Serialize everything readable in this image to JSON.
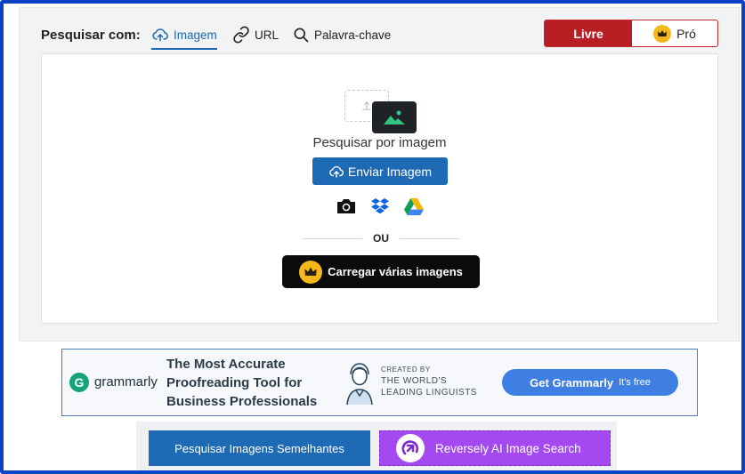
{
  "search": {
    "label": "Pesquisar com:",
    "modes": [
      {
        "label": "Imagem",
        "icon": "cloud-upload-icon",
        "active": true
      },
      {
        "label": "URL",
        "icon": "link-icon",
        "active": false
      },
      {
        "label": "Palavra-chave",
        "icon": "search-icon",
        "active": false
      }
    ],
    "plans": {
      "free": "Livre",
      "pro": "Pró"
    }
  },
  "drop_zone": {
    "title": "Pesquisar por imagem",
    "upload_button": "Enviar Imagem",
    "sources": [
      "camera-icon",
      "dropbox-icon",
      "google-drive-icon"
    ],
    "divider": "OU",
    "multi_button": "Carregar várias imagens"
  },
  "ad": {
    "brand": "grammarly",
    "headline_lines": [
      "The Most Accurate",
      "Proofreading Tool for",
      "Business Professionals"
    ],
    "credit_small": "CREATED BY",
    "credit_lines": [
      "THE WORLD'S",
      "LEADING LINGUISTS"
    ],
    "cta": "Get Grammarly",
    "cta_note": "It's free"
  },
  "bottom": {
    "similar_button": "Pesquisar Imagens Semelhantes",
    "reversely_button": "Reversely AI Image Search"
  },
  "colors": {
    "frame": "#0a43c6",
    "primary_blue": "#1f6ab5",
    "free_red": "#b81f25",
    "crown_gold": "#f4b81a",
    "reversely_purple": "#a448f2"
  }
}
